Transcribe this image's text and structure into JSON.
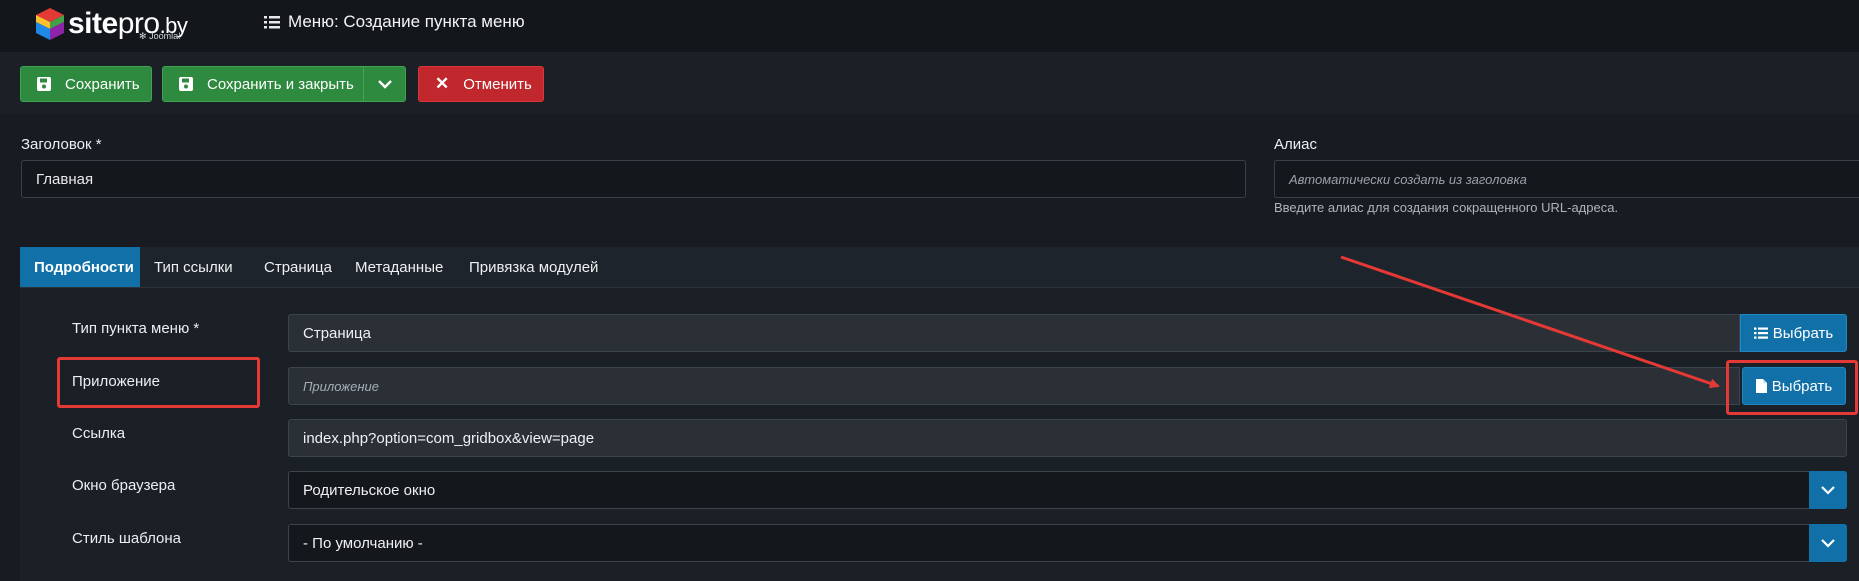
{
  "brand": {
    "name_bold": "site",
    "name_rest": "pro",
    "name_suffix": ".by",
    "sub": "Joomla!"
  },
  "header": {
    "title": "Меню: Создание пункта меню"
  },
  "toolbar": {
    "save_label": "Сохранить",
    "save_close_label": "Сохранить и закрыть",
    "cancel_label": "Отменить"
  },
  "form": {
    "title_label": "Заголовок *",
    "title_value": "Главная",
    "alias_label": "Алиас",
    "alias_placeholder": "Автоматически создать из заголовка",
    "alias_hint": "Введите алиас для создания сокращенного URL-адреса."
  },
  "tabs": [
    {
      "label": "Подробности",
      "active": true
    },
    {
      "label": "Тип ссылки",
      "active": false
    },
    {
      "label": "Страница",
      "active": false
    },
    {
      "label": "Метаданные",
      "active": false
    },
    {
      "label": "Привязка модулей",
      "active": false
    }
  ],
  "details": {
    "type_label": "Тип пункта меню *",
    "type_value": "Страница",
    "type_button": "Выбрать",
    "app_label": "Приложение",
    "app_placeholder": "Приложение",
    "app_button": "Выбрать",
    "link_label": "Ссылка",
    "link_value": "index.php?option=com_gridbox&view=page",
    "window_label": "Окно браузера",
    "window_value": "Родительское окно",
    "style_label": "Стиль шаблона",
    "style_value": "- По умолчанию -"
  },
  "colors": {
    "accent_blue": "#1170a8",
    "save_green": "#2e8a3e",
    "cancel_red": "#c0282d",
    "annotation_red": "#e53935"
  }
}
